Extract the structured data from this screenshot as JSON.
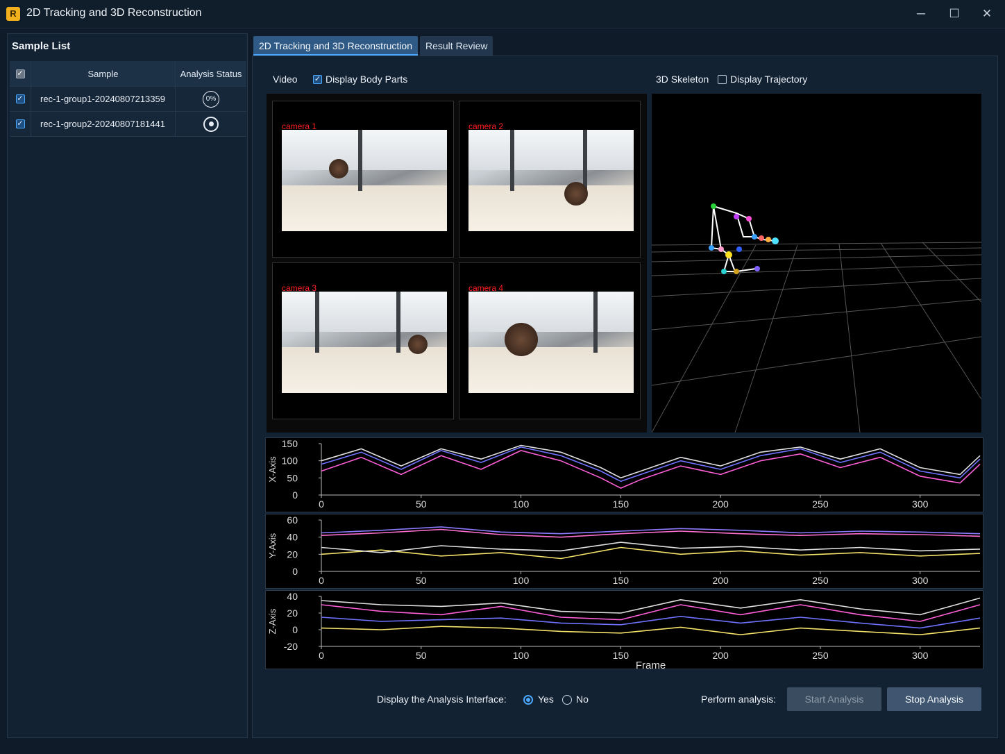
{
  "window": {
    "title": "2D Tracking and 3D Reconstruction",
    "app_icon_glyph": "R",
    "minimize_glyph": "─",
    "maximize_glyph": "☐",
    "close_glyph": "✕"
  },
  "sample_list": {
    "heading": "Sample List",
    "columns": {
      "sample": "Sample",
      "status": "Analysis Status"
    },
    "rows": [
      {
        "name": "rec-1-group1-20240807213359",
        "status": "0%",
        "checked": true
      },
      {
        "name": "rec-1-group2-20240807181441",
        "status": "recording",
        "checked": true
      }
    ]
  },
  "tabs": [
    {
      "label": "2D Tracking and 3D Reconstruction",
      "active": true
    },
    {
      "label": "Result Review",
      "active": false
    }
  ],
  "video": {
    "label": "Video",
    "display_body_parts_label": "Display Body Parts",
    "display_body_parts_checked": true,
    "cameras": [
      "camera 1",
      "camera 2",
      "camera 3",
      "camera 4"
    ]
  },
  "skeleton": {
    "label": "3D Skeleton",
    "display_trajectory_label": "Display Trajectory",
    "display_trajectory_checked": false
  },
  "chart_data": [
    {
      "type": "line",
      "ylabel": "X-Axis",
      "xlabel": "",
      "xlim": [
        0,
        330
      ],
      "ylim": [
        0,
        150
      ],
      "xticks": [
        "0",
        "50",
        "100",
        "150",
        "200",
        "250",
        "300"
      ],
      "yticks": [
        "150",
        "100",
        "50",
        "0"
      ],
      "series": [
        {
          "color": "#ff5fd7",
          "x": [
            0,
            20,
            40,
            60,
            80,
            100,
            120,
            140,
            150,
            160,
            180,
            200,
            220,
            240,
            260,
            280,
            300,
            320,
            330
          ],
          "y": [
            70,
            110,
            60,
            115,
            75,
            130,
            100,
            50,
            20,
            45,
            85,
            60,
            100,
            120,
            80,
            110,
            55,
            35,
            90
          ]
        },
        {
          "color": "#6f73ff",
          "x": [
            0,
            20,
            40,
            60,
            80,
            100,
            120,
            140,
            150,
            160,
            180,
            200,
            220,
            240,
            260,
            280,
            300,
            320,
            330
          ],
          "y": [
            90,
            125,
            75,
            130,
            95,
            140,
            115,
            70,
            40,
            60,
            100,
            75,
            115,
            135,
            95,
            125,
            70,
            50,
            105
          ]
        },
        {
          "color": "#e0e0e0",
          "x": [
            0,
            20,
            40,
            60,
            80,
            100,
            120,
            140,
            150,
            160,
            180,
            200,
            220,
            240,
            260,
            280,
            300,
            320,
            330
          ],
          "y": [
            100,
            135,
            85,
            135,
            105,
            145,
            125,
            80,
            50,
            70,
            110,
            85,
            125,
            140,
            105,
            135,
            80,
            60,
            115
          ]
        }
      ]
    },
    {
      "type": "line",
      "ylabel": "Y-Axis",
      "xlabel": "",
      "xlim": [
        0,
        330
      ],
      "ylim": [
        0,
        60
      ],
      "xticks": [
        "0",
        "50",
        "100",
        "150",
        "200",
        "250",
        "300"
      ],
      "yticks": [
        "60",
        "40",
        "20",
        "0"
      ],
      "series": [
        {
          "color": "#8a7bff",
          "x": [
            0,
            30,
            60,
            90,
            120,
            150,
            180,
            210,
            240,
            270,
            300,
            330
          ],
          "y": [
            45,
            48,
            52,
            46,
            44,
            47,
            50,
            48,
            45,
            47,
            46,
            44
          ]
        },
        {
          "color": "#ff6fd0",
          "x": [
            0,
            30,
            60,
            90,
            120,
            150,
            180,
            210,
            240,
            270,
            300,
            330
          ],
          "y": [
            42,
            45,
            49,
            43,
            40,
            44,
            47,
            44,
            42,
            44,
            43,
            41
          ]
        },
        {
          "color": "#f5e26a",
          "x": [
            0,
            30,
            60,
            90,
            120,
            150,
            180,
            210,
            240,
            270,
            300,
            330
          ],
          "y": [
            20,
            25,
            18,
            22,
            15,
            28,
            20,
            24,
            19,
            22,
            18,
            21
          ]
        },
        {
          "color": "#e0e0e0",
          "x": [
            0,
            30,
            60,
            90,
            120,
            150,
            180,
            210,
            240,
            270,
            300,
            330
          ],
          "y": [
            28,
            22,
            30,
            26,
            24,
            34,
            27,
            29,
            25,
            28,
            24,
            26
          ]
        }
      ]
    },
    {
      "type": "line",
      "ylabel": "Z-Axis",
      "xlabel": "Frame",
      "xlim": [
        0,
        330
      ],
      "ylim": [
        -20,
        40
      ],
      "xticks": [
        "0",
        "50",
        "100",
        "150",
        "200",
        "250",
        "300"
      ],
      "yticks": [
        "40",
        "20",
        "0",
        "-20"
      ],
      "series": [
        {
          "color": "#e0e0e0",
          "x": [
            0,
            30,
            60,
            90,
            120,
            150,
            180,
            210,
            240,
            270,
            300,
            330
          ],
          "y": [
            35,
            30,
            28,
            32,
            22,
            20,
            36,
            26,
            36,
            25,
            18,
            38
          ]
        },
        {
          "color": "#ff5fd7",
          "x": [
            0,
            30,
            60,
            90,
            120,
            150,
            180,
            210,
            240,
            270,
            300,
            330
          ],
          "y": [
            30,
            22,
            18,
            28,
            15,
            12,
            30,
            18,
            30,
            18,
            10,
            30
          ]
        },
        {
          "color": "#6f73ff",
          "x": [
            0,
            30,
            60,
            90,
            120,
            150,
            180,
            210,
            240,
            270,
            300,
            330
          ],
          "y": [
            15,
            10,
            12,
            14,
            8,
            6,
            16,
            8,
            15,
            8,
            2,
            14
          ]
        },
        {
          "color": "#f5e26a",
          "x": [
            0,
            30,
            60,
            90,
            120,
            150,
            180,
            210,
            240,
            270,
            300,
            330
          ],
          "y": [
            2,
            0,
            4,
            2,
            -2,
            -4,
            3,
            -6,
            2,
            -2,
            -6,
            2
          ]
        }
      ]
    }
  ],
  "bottom": {
    "display_label": "Display the Analysis Interface:",
    "yes_label": "Yes",
    "no_label": "No",
    "selected": "Yes",
    "perform_label": "Perform analysis:",
    "start_label": "Start Analysis",
    "stop_label": "Stop Analysis"
  }
}
